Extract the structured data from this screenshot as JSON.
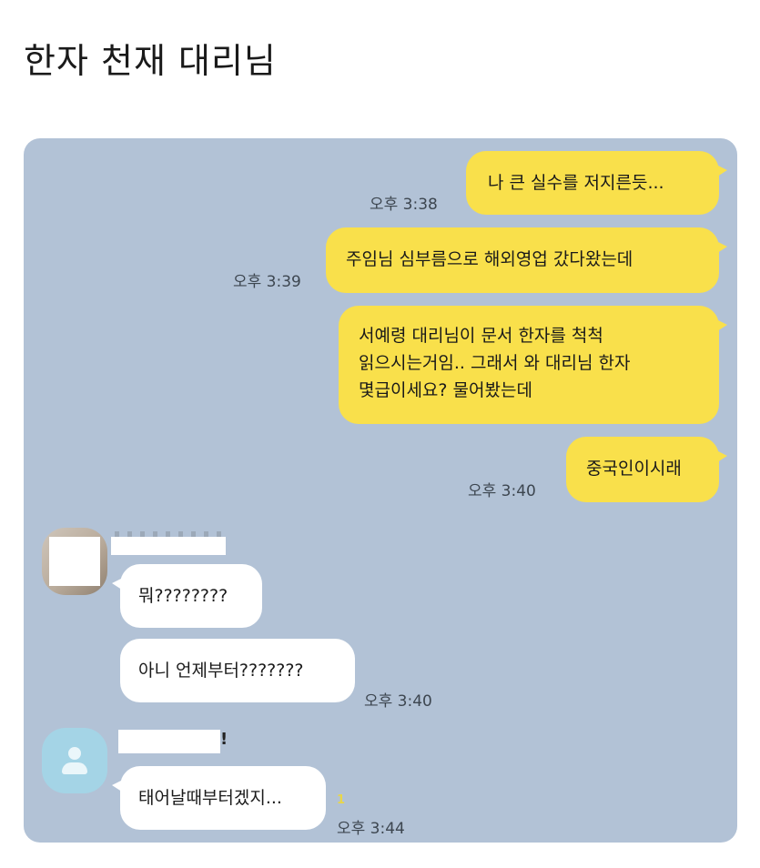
{
  "post": {
    "title": "한자 천재 대리님"
  },
  "chat": {
    "colors": {
      "background": "#b2c2d6",
      "my_bubble": "#f9e04b",
      "other_bubble": "#ffffff"
    },
    "messages": [
      {
        "sender": "me",
        "text": "나 큰 실수를 저지른듯...",
        "time": "오후 3:38"
      },
      {
        "sender": "me",
        "text": "주임님 심부름으로 해외영업 갔다왔는데",
        "time": "오후 3:39"
      },
      {
        "sender": "me",
        "lines": [
          "서예령 대리님이 문서 한자를 척척",
          "읽으시는거임.. 그래서 와 대리님 한자",
          "몇급이세요? 물어봤는데"
        ]
      },
      {
        "sender": "me",
        "text": "중국인이시래",
        "time": "오후 3:40"
      },
      {
        "sender": "other",
        "text": "뭐????????"
      },
      {
        "sender": "other",
        "text": "아니 언제부터???????",
        "time": "오후 3:40"
      },
      {
        "sender": "other2",
        "name_suffix": "!",
        "text": "태어날때부터겠지...",
        "unread": "1",
        "time": "오후 3:44"
      }
    ]
  }
}
